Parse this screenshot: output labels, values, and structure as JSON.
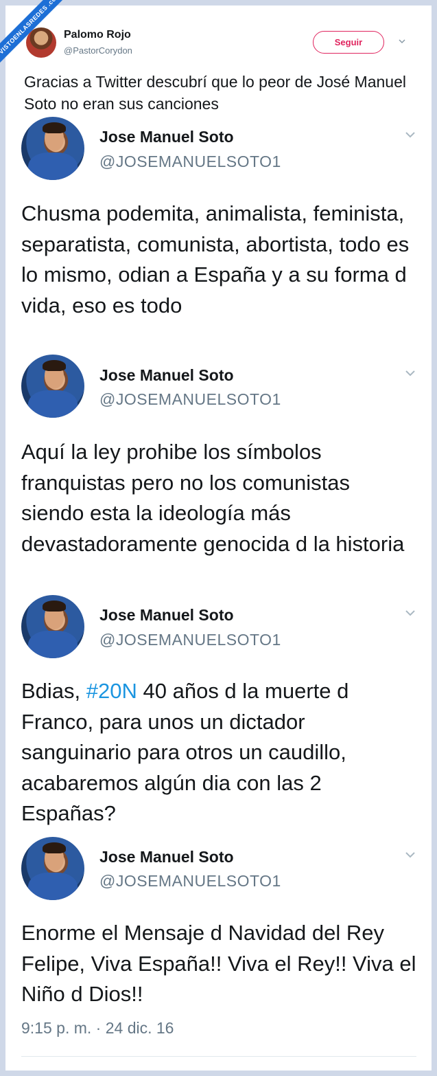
{
  "watermark": {
    "text": "VISTOENLASREDES .com"
  },
  "header_tweet": {
    "name": "Palomo Rojo",
    "handle": "@PastorCorydon",
    "follow_label": "Seguir",
    "text": "Gracias a Twitter descubrí que lo peor de José Manuel Soto no eran sus canciones"
  },
  "embedded_tweets": [
    {
      "name": "Jose Manuel Soto",
      "handle": "@JOSEMANUELSOTO1",
      "text": "Chusma podemita, animalista, feminista, separatista, comunista, abortista, todo es lo mismo, odian a España y a su forma d vida, eso es todo"
    },
    {
      "name": "Jose Manuel Soto",
      "handle": "@JOSEMANUELSOTO1",
      "text": "Aquí la ley prohibe los símbolos franquistas pero no los comunistas siendo esta la ideología más devastadoramente genocida d la historia"
    },
    {
      "name": "Jose Manuel Soto",
      "handle": "@JOSEMANUELSOTO1",
      "text_before": "Bdias, ",
      "hashtag": "#20N",
      "text_after": " 40 años d la muerte d Franco, para unos un dictador sanguinario para otros un caudillo, acabaremos algún dia con las 2 Españas?"
    },
    {
      "name": "Jose Manuel Soto",
      "handle": "@JOSEMANUELSOTO1",
      "text": "Enorme el Mensaje d Navidad del Rey Felipe, Viva España!! Viva el Rey!! Viva el Niño d Dios!!",
      "timestamp": "9:15 p. m. · 24 dic. 16"
    }
  ],
  "colors": {
    "follow": "#e0245e",
    "hashtag": "#1b95e0",
    "muted": "#657786",
    "frame": "#cfd8e8"
  }
}
